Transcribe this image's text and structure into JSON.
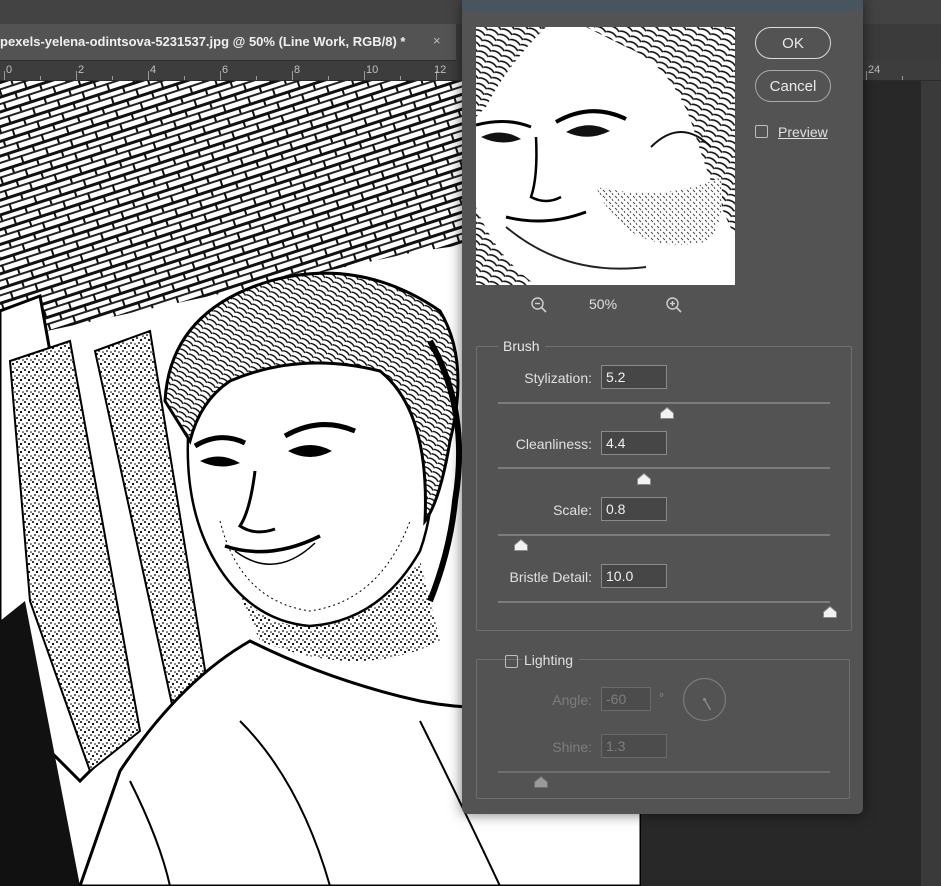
{
  "document": {
    "tab_title": "pexels-yelena-odintsova-5231537.jpg @ 50% (Line Work, RGB/8) *",
    "close_glyph": "×",
    "ruler_labels": [
      "0",
      "2",
      "4",
      "6",
      "8",
      "10",
      "12",
      "24"
    ]
  },
  "dialog": {
    "ok_label": "OK",
    "cancel_label": "Cancel",
    "preview_label": "Preview",
    "preview_checked": false,
    "zoom_value": "50%",
    "zoom_out_icon": "zoom-out-icon",
    "zoom_in_icon": "zoom-in-icon",
    "brush": {
      "legend": "Brush",
      "params": [
        {
          "label": "Stylization:",
          "value": "5.2",
          "level": 0.51
        },
        {
          "label": "Cleanliness:",
          "value": "4.4",
          "level": 0.44
        },
        {
          "label": "Scale:",
          "value": "0.8",
          "level": 0.07
        },
        {
          "label": "Bristle Detail:",
          "value": "10.0",
          "level": 1.0
        }
      ]
    },
    "lighting": {
      "label": "Lighting",
      "checked": false,
      "angle_label": "Angle:",
      "angle_value": "-60",
      "angle_unit": "°",
      "shine_label": "Shine:",
      "shine_value": "1.3",
      "shine_level": 0.13
    }
  },
  "colors": {
    "panel": "#535353",
    "pasteboard": "#282828",
    "titlebar": "#48555f"
  }
}
